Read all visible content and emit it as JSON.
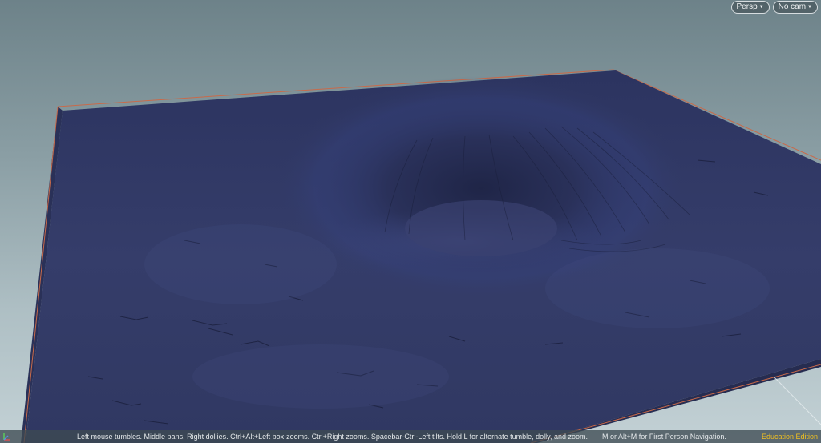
{
  "viewport": {
    "camera_view": "Persp",
    "camera_object": "No cam"
  },
  "status_bar": {
    "navigation_hint": "Left mouse tumbles. Middle pans. Right dollies. Ctrl+Alt+Left box-zooms. Ctrl+Right zooms. Spacebar-Ctrl-Left tilts. Hold L for alternate tumble, dolly, and zoom.",
    "first_person_hint": "M or Alt+M for First Person Navigation.",
    "edition_label": "Education Edition"
  },
  "axis_gizmo": {
    "axes": [
      "x",
      "y",
      "z"
    ]
  },
  "colors": {
    "background_top": "#6d8289",
    "background_bottom": "#c3d1d5",
    "terrain": "#323a64",
    "bounding_box": "#c86a4a",
    "edition_text": "#f0c020"
  },
  "icons": {
    "dropdown": "chevron-down-icon",
    "axis": "axis-gizmo-icon"
  }
}
